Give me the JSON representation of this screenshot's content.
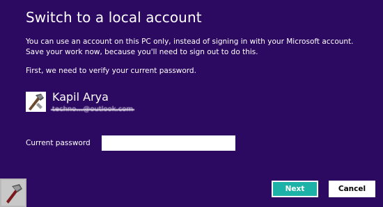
{
  "dialog": {
    "title": "Switch to a local account",
    "description": "You can use an account on this PC only, instead of signing in with your Microsoft account. Save your work now, because you'll need to sign out to do this.",
    "verify_text": "First, we need to verify your current password."
  },
  "user": {
    "name": "Kapil Arya",
    "email": "techno…@outlook.com",
    "avatar_icon": "tools-icon"
  },
  "password": {
    "label": "Current password",
    "value": "",
    "placeholder": ""
  },
  "buttons": {
    "next_label": "Next",
    "cancel_label": "Cancel"
  },
  "branding": {
    "logo_icon": "hammer-icon"
  },
  "colors": {
    "background": "#2d0a62",
    "next_button": "#1db2a8",
    "text": "#ffffff"
  }
}
